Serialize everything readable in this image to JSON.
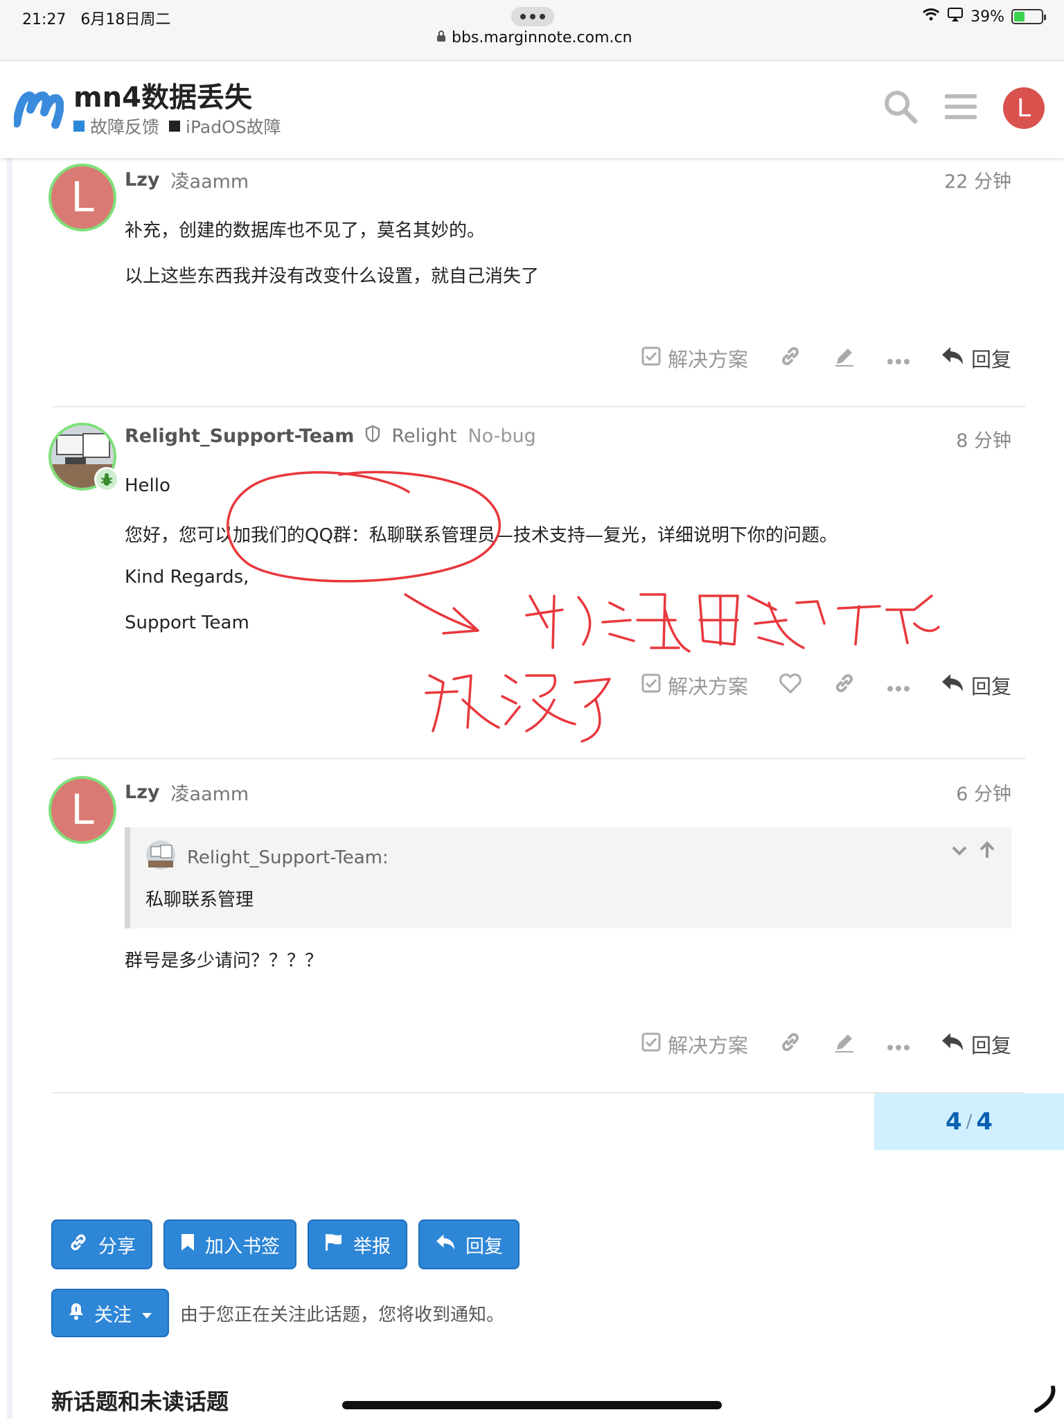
{
  "status_bar": {
    "time": "21:27",
    "date": "6月18日周二",
    "url": "bbs.marginnote.com.cn",
    "battery": "39%",
    "battery_level": 0.39
  },
  "header": {
    "title": "mn4数据丢失",
    "categories": [
      {
        "label": "故障反馈",
        "color": "#2c88d9"
      },
      {
        "label": "iPadOS故障",
        "color": "#222222"
      }
    ],
    "avatar_letter": "L"
  },
  "posts": [
    {
      "avatar_letter": "L",
      "username": "Lzy",
      "fullname": "凌aamm",
      "time": "22 分钟",
      "paragraphs": [
        "补充，创建的数据库也不见了，莫名其妙的。",
        "以上这些东西我并没有改变什么设置，就自己消失了"
      ],
      "actions": {
        "solution": "解决方案",
        "reply": "回复"
      }
    },
    {
      "username": "Relight_Support-Team",
      "fullname": "Relight",
      "title": "No-bug",
      "time": "8 分钟",
      "paragraphs": [
        "Hello",
        "您好，您可以加我们的QQ群：私聊联系管理员—技术支持—复光，详细说明下你的问题。",
        "Kind Regards,",
        "Support Team"
      ],
      "actions": {
        "solution": "解决方案",
        "reply": "回复"
      }
    },
    {
      "avatar_letter": "L",
      "username": "Lzy",
      "fullname": "凌aamm",
      "time": "6 分钟",
      "quote": {
        "author": "Relight_Support-Team:",
        "text": "私聊联系管理"
      },
      "paragraphs": [
        "群号是多少请问？？？？"
      ],
      "actions": {
        "solution": "解决方案",
        "reply": "回复"
      }
    }
  ],
  "progress": {
    "current": "4",
    "total": "4"
  },
  "footer_buttons": {
    "share": "分享",
    "bookmark": "加入书签",
    "flag": "举报",
    "reply": "回复"
  },
  "notification": {
    "level": "关注",
    "text": "由于您正在关注此话题，您将收到通知。"
  },
  "topics_heading": "新话题和未读话题"
}
